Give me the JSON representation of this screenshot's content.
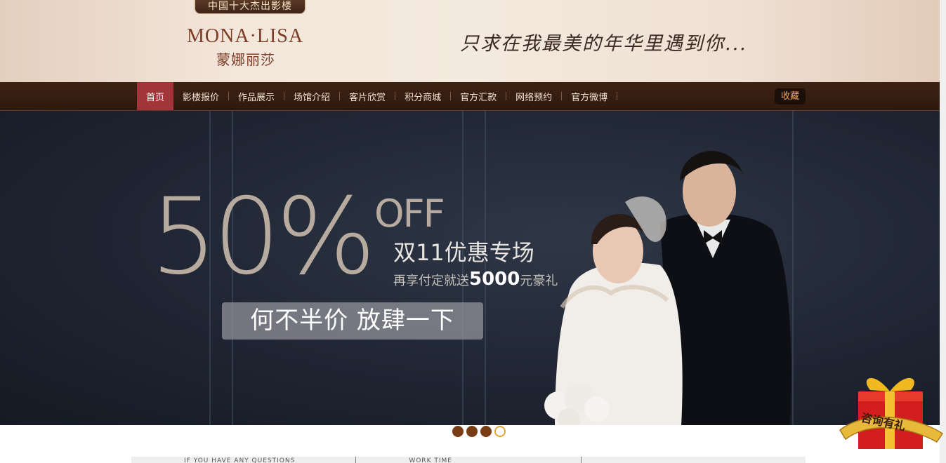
{
  "header": {
    "badge": "中国十大杰出影楼",
    "logo_en": "MONA·LISA",
    "logo_cn": "蒙娜丽莎",
    "slogan": "只求在我最美的年华里遇到你..."
  },
  "nav": {
    "items": [
      {
        "label": "首页",
        "active": true
      },
      {
        "label": "影楼报价"
      },
      {
        "label": "作品展示"
      },
      {
        "label": "场馆介绍"
      },
      {
        "label": "客片欣赏"
      },
      {
        "label": "积分商城"
      },
      {
        "label": "官方汇款"
      },
      {
        "label": "网络预约"
      },
      {
        "label": "官方微博"
      }
    ],
    "favorite": "收藏"
  },
  "banner": {
    "discount": "50%",
    "off": "OFF",
    "title": "双11优惠专场",
    "sub_prefix": "再享付定就送",
    "sub_amount": "5000",
    "sub_suffix": "元豪礼",
    "cta": "何不半价 放肆一下"
  },
  "slider": {
    "count": 4,
    "active_index": 3
  },
  "bottom": {
    "col1": "IF YOU HAVE ANY QUESTIONS",
    "col2": "WORK TIME",
    "col3": ""
  },
  "gift": {
    "label": "咨询有礼"
  },
  "colors": {
    "nav_bg": "#3e2212",
    "nav_active": "#a3353a",
    "brand": "#7e3c26",
    "dot": "#7a3e17"
  }
}
